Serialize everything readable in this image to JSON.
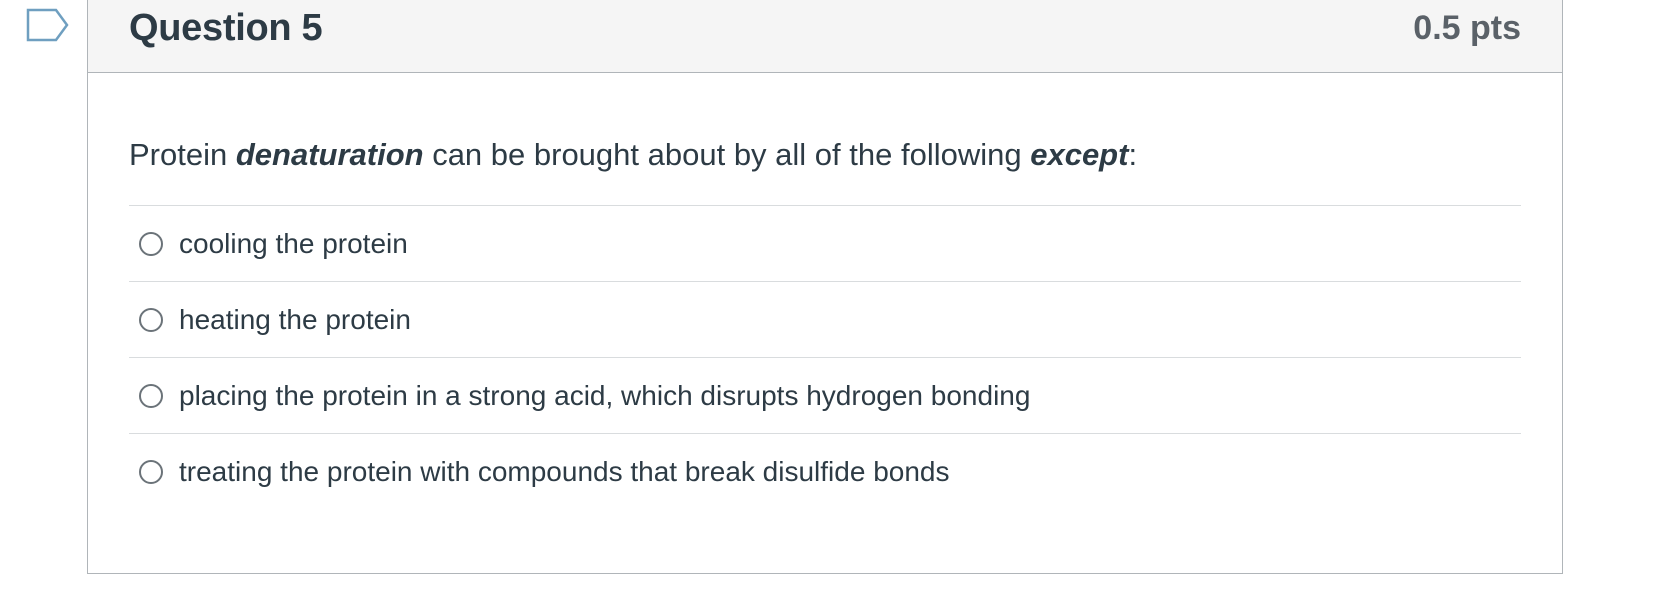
{
  "question": {
    "title": "Question 5",
    "points": "0.5 pts",
    "text_parts": {
      "p1": "Protein ",
      "p2": "denaturation",
      "p3": " can be brought about by all of the following ",
      "p4": "except",
      "p5": ":"
    },
    "answers": [
      {
        "label": "cooling the protein",
        "selected": false
      },
      {
        "label": "heating the protein",
        "selected": false
      },
      {
        "label": "placing the protein in a strong acid, which disrupts hydrogen bonding",
        "selected": false
      },
      {
        "label": "treating the protein with compounds that break disulfide bonds",
        "selected": false
      }
    ]
  },
  "icons": {
    "flag": "flag-outline-icon"
  },
  "colors": {
    "flag_stroke": "#6f9fc0",
    "header_bg": "#f5f5f5",
    "text": "#2d3b45"
  }
}
